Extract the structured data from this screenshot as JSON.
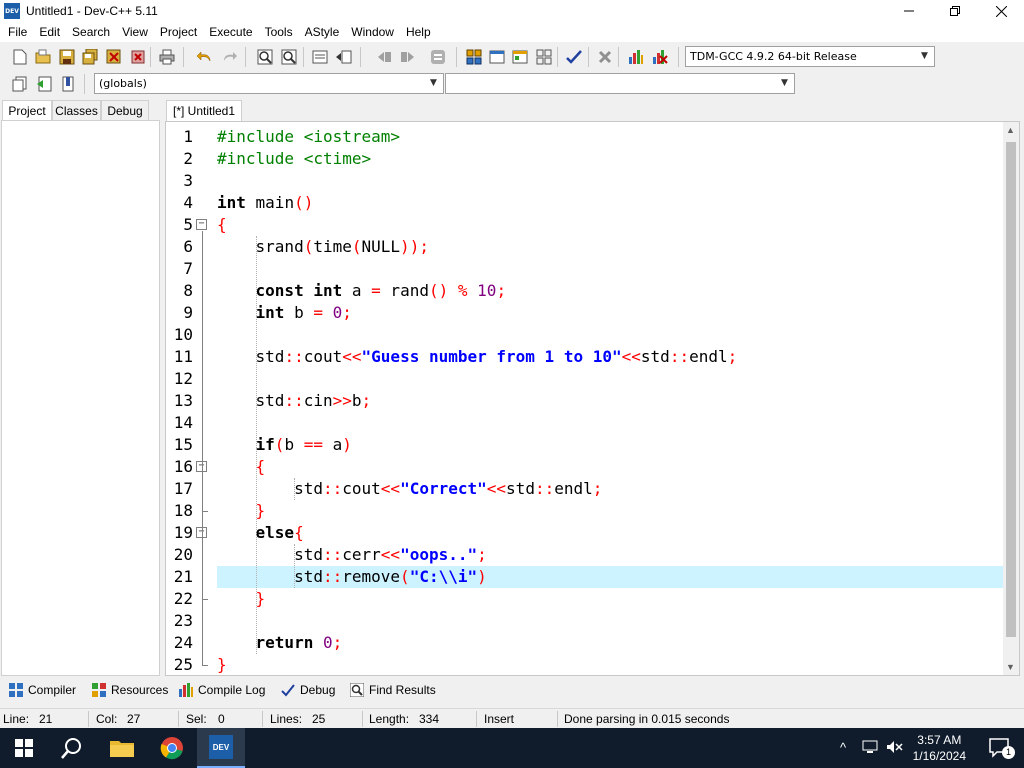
{
  "window": {
    "title": "Untitled1 - Dev-C++ 5.11",
    "app_icon_text": "DEV"
  },
  "menu": [
    "File",
    "Edit",
    "Search",
    "View",
    "Project",
    "Execute",
    "Tools",
    "AStyle",
    "Window",
    "Help"
  ],
  "toolbar": {
    "compiler_select": "TDM-GCC 4.9.2 64-bit Release",
    "scope_select": "(globals)",
    "symbol_select": ""
  },
  "left_panel": {
    "tabs": [
      "Project",
      "Classes",
      "Debug"
    ],
    "active_tab": "Project"
  },
  "editor": {
    "tab_label": "[*] Untitled1",
    "current_line": 21,
    "lines": [
      "#include <iostream>",
      "#include <ctime>",
      "",
      "int main()",
      "{",
      "    srand(time(NULL));",
      "",
      "    const int a = rand() % 10;",
      "    int b = 0;",
      "",
      "    std::cout<<\"Guess number from 1 to 10\"<<std::endl;",
      "",
      "    std::cin>>b;",
      "",
      "    if(b == a)",
      "    {",
      "        std::cout<<\"Correct\"<<std::endl;",
      "    }",
      "    else{",
      "        std::cerr<<\"oops..\";",
      "        std::remove(\"C:\\\\i\")",
      "    }",
      "",
      "    return 0;",
      "}"
    ],
    "line_numbers": [
      "1",
      "2",
      "3",
      "4",
      "5",
      "6",
      "7",
      "8",
      "9",
      "10",
      "11",
      "12",
      "13",
      "14",
      "15",
      "16",
      "17",
      "18",
      "19",
      "20",
      "21",
      "22",
      "23",
      "24",
      "25"
    ]
  },
  "bottom_tabs": [
    "Compiler",
    "Resources",
    "Compile Log",
    "Debug",
    "Find Results"
  ],
  "status": {
    "line_label": "Line:",
    "line_value": "21",
    "col_label": "Col:",
    "col_value": "27",
    "sel_label": "Sel:",
    "sel_value": "0",
    "lines_label": "Lines:",
    "lines_value": "25",
    "length_label": "Length:",
    "length_value": "334",
    "mode": "Insert",
    "message": "Done parsing in 0.015 seconds"
  },
  "taskbar": {
    "time": "3:57 AM",
    "date": "1/16/2024",
    "notification_count": "1"
  },
  "colors": {
    "keyword": "#000000",
    "preprocessor": "#008000",
    "string": "#0000ff",
    "number": "#800080",
    "symbol": "#ff0000",
    "current_line": "#ccf3ff",
    "taskbar": "#101c2c"
  }
}
